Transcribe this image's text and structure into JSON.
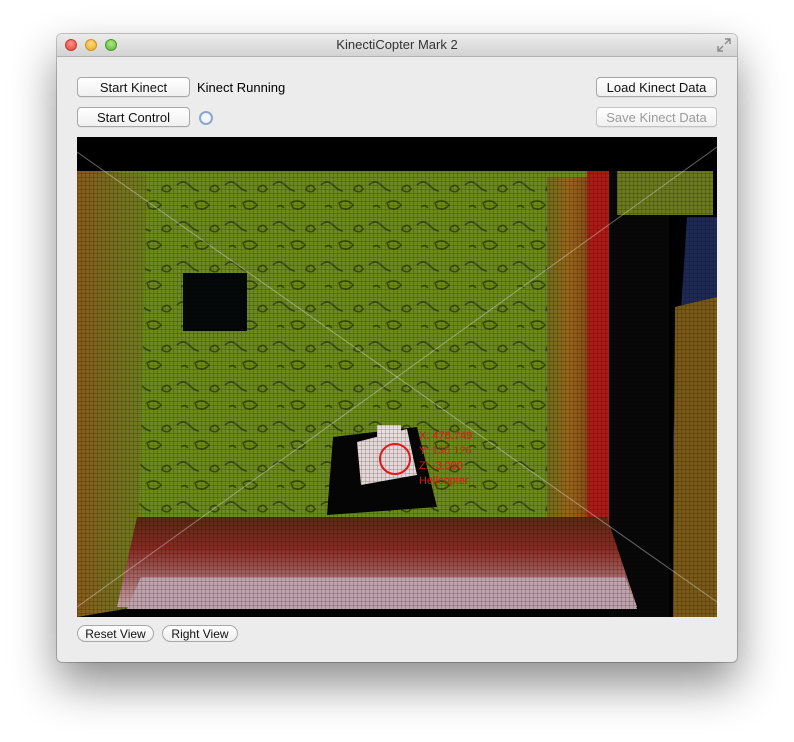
{
  "window": {
    "title": "KinectiCopter Mark 2"
  },
  "toolbar": {
    "start_kinect_label": "Start Kinect",
    "kinect_status": "Kinect Running",
    "start_control_label": "Start Control",
    "load_data_label": "Load Kinect Data",
    "save_data_label": "Save Kinect Data",
    "save_data_enabled": false
  },
  "viewport": {
    "tracking": {
      "x_label": "X: 476.749",
      "y_label": "Y: 136.126",
      "z_label": "Z: -3.090",
      "target_label": "Helicopter",
      "marker_color": "#e01818"
    }
  },
  "view_controls": {
    "reset_label": "Reset View",
    "right_label": "Right View"
  },
  "icons": {
    "close": "close-icon",
    "minimize": "minimize-icon",
    "zoom": "zoom-icon",
    "fullscreen": "fullscreen-icon",
    "control_indicator": "status-indicator-icon"
  },
  "colors": {
    "window_bg": "#ececec",
    "status_indicator": "#8aa6d6",
    "disabled_text": "#9a9a9a"
  }
}
